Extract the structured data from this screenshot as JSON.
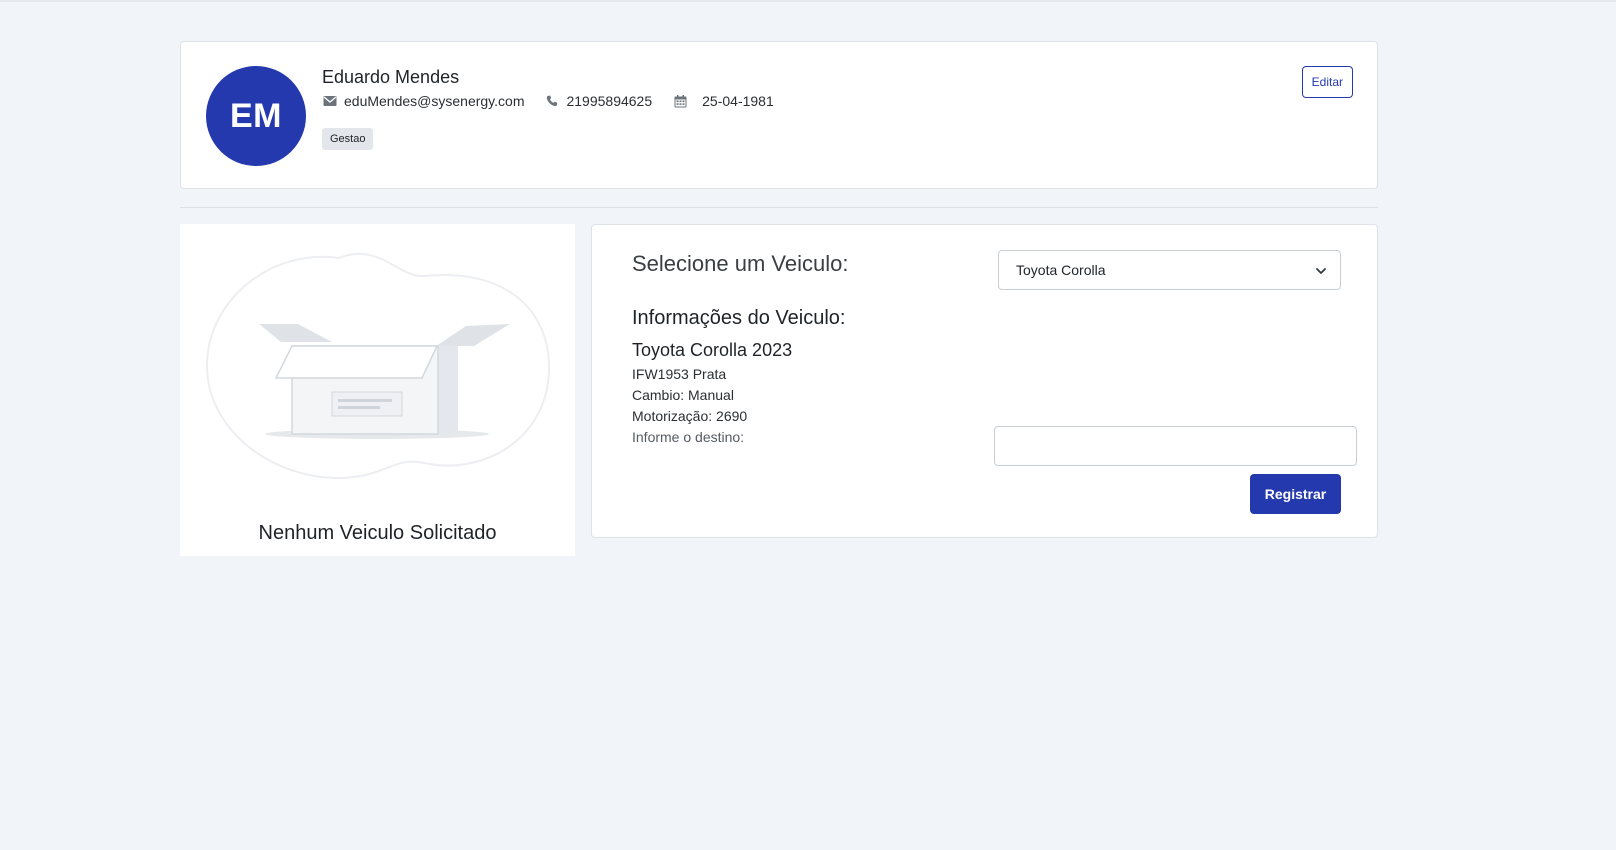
{
  "profile": {
    "initials": "EM",
    "name": "Eduardo Mendes",
    "email": "eduMendes@sysenergy.com",
    "phone": "21995894625",
    "birthdate": "25-04-1981",
    "role": "Gestao",
    "edit_label": "Editar",
    "colors": {
      "accent": "#2439ad"
    }
  },
  "empty_state": {
    "message": "Nenhum Veiculo Solicitado"
  },
  "vehicle_form": {
    "select_label": "Selecione um Veiculo:",
    "selected_vehicle": "Toyota Corolla",
    "info_title": "Informações do Veiculo:",
    "model": "Toyota Corolla 2023",
    "plate_color": "IFW1953 Prata",
    "transmission": "Cambio: Manual",
    "engine": "Motorização: 2690",
    "destination_label": "Informe o destino:",
    "destination_value": "",
    "register_label": "Registrar"
  }
}
